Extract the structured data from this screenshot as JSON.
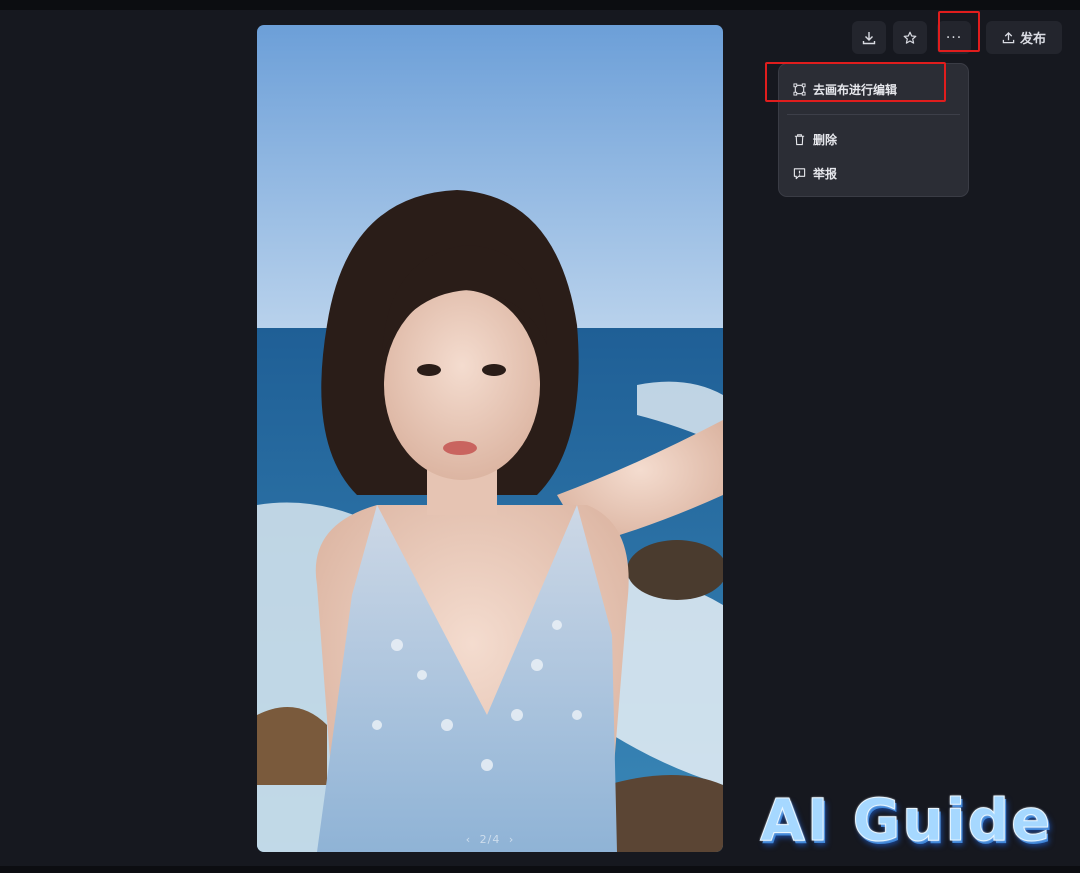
{
  "toolbar": {
    "publish_label": "发布",
    "more_label": "···"
  },
  "menu": {
    "edit_in_canvas": "去画布进行编辑",
    "delete": "删除",
    "report": "举报"
  },
  "image": {
    "pager_text": "2/4",
    "prev_glyph": "‹",
    "next_glyph": "›"
  },
  "watermark": {
    "text": "AI Guide"
  },
  "colors": {
    "background": "#16181f",
    "button_bg": "#23252d",
    "menu_bg": "#2b2d35",
    "highlight": "#e01d1d"
  }
}
